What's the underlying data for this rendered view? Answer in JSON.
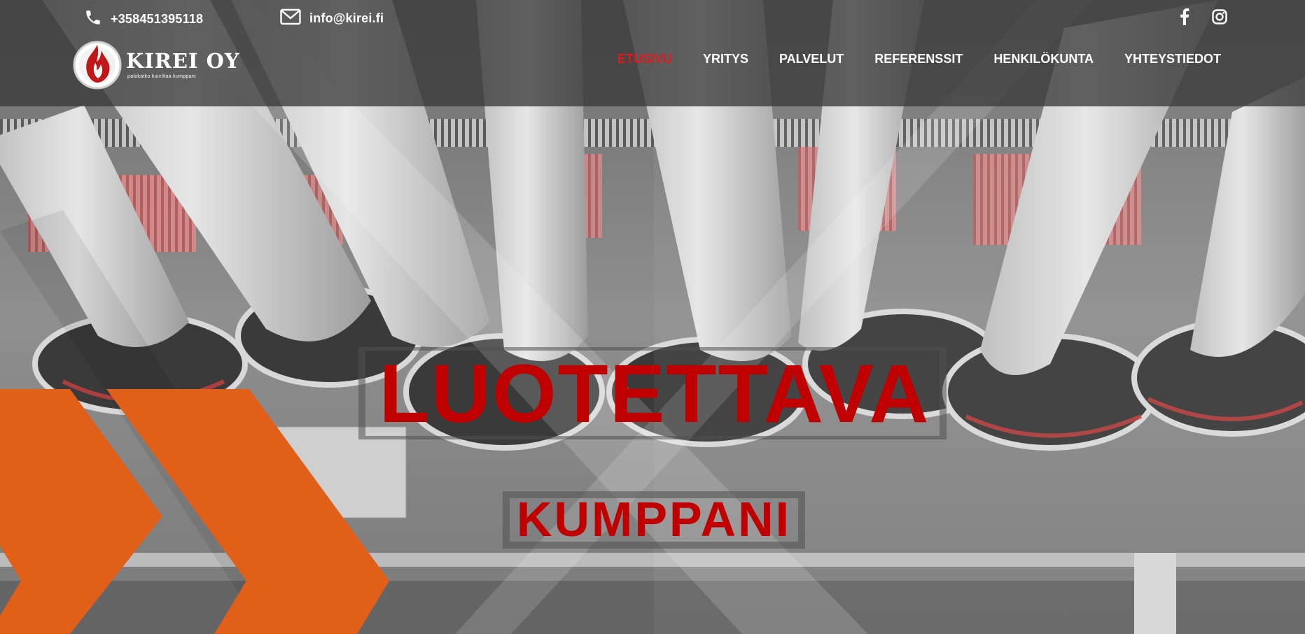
{
  "topbar": {
    "phone": "+358451395118",
    "email": "info@kirei.fi",
    "social": [
      "facebook-icon",
      "instagram-icon"
    ]
  },
  "logo": {
    "name": "KIREI OY",
    "tagline": "palokatko kuiviltaa kumppani"
  },
  "nav": {
    "items": [
      {
        "label": "ETUSIVU",
        "active": true
      },
      {
        "label": "YRITYS",
        "active": false
      },
      {
        "label": "PALVELUT",
        "active": false
      },
      {
        "label": "REFERENSSIT",
        "active": false
      },
      {
        "label": "HENKILÖKUNTA",
        "active": false
      },
      {
        "label": "YHTEYSTIEDOT",
        "active": false
      }
    ]
  },
  "hero": {
    "headline": "LUOTETTAVA",
    "subheadline": "KUMPPANI"
  },
  "colors": {
    "accent_red": "#c00000",
    "nav_active": "#e01b1b",
    "chevron_orange": "#e0601a",
    "header_bg": "#3a3a3a"
  }
}
